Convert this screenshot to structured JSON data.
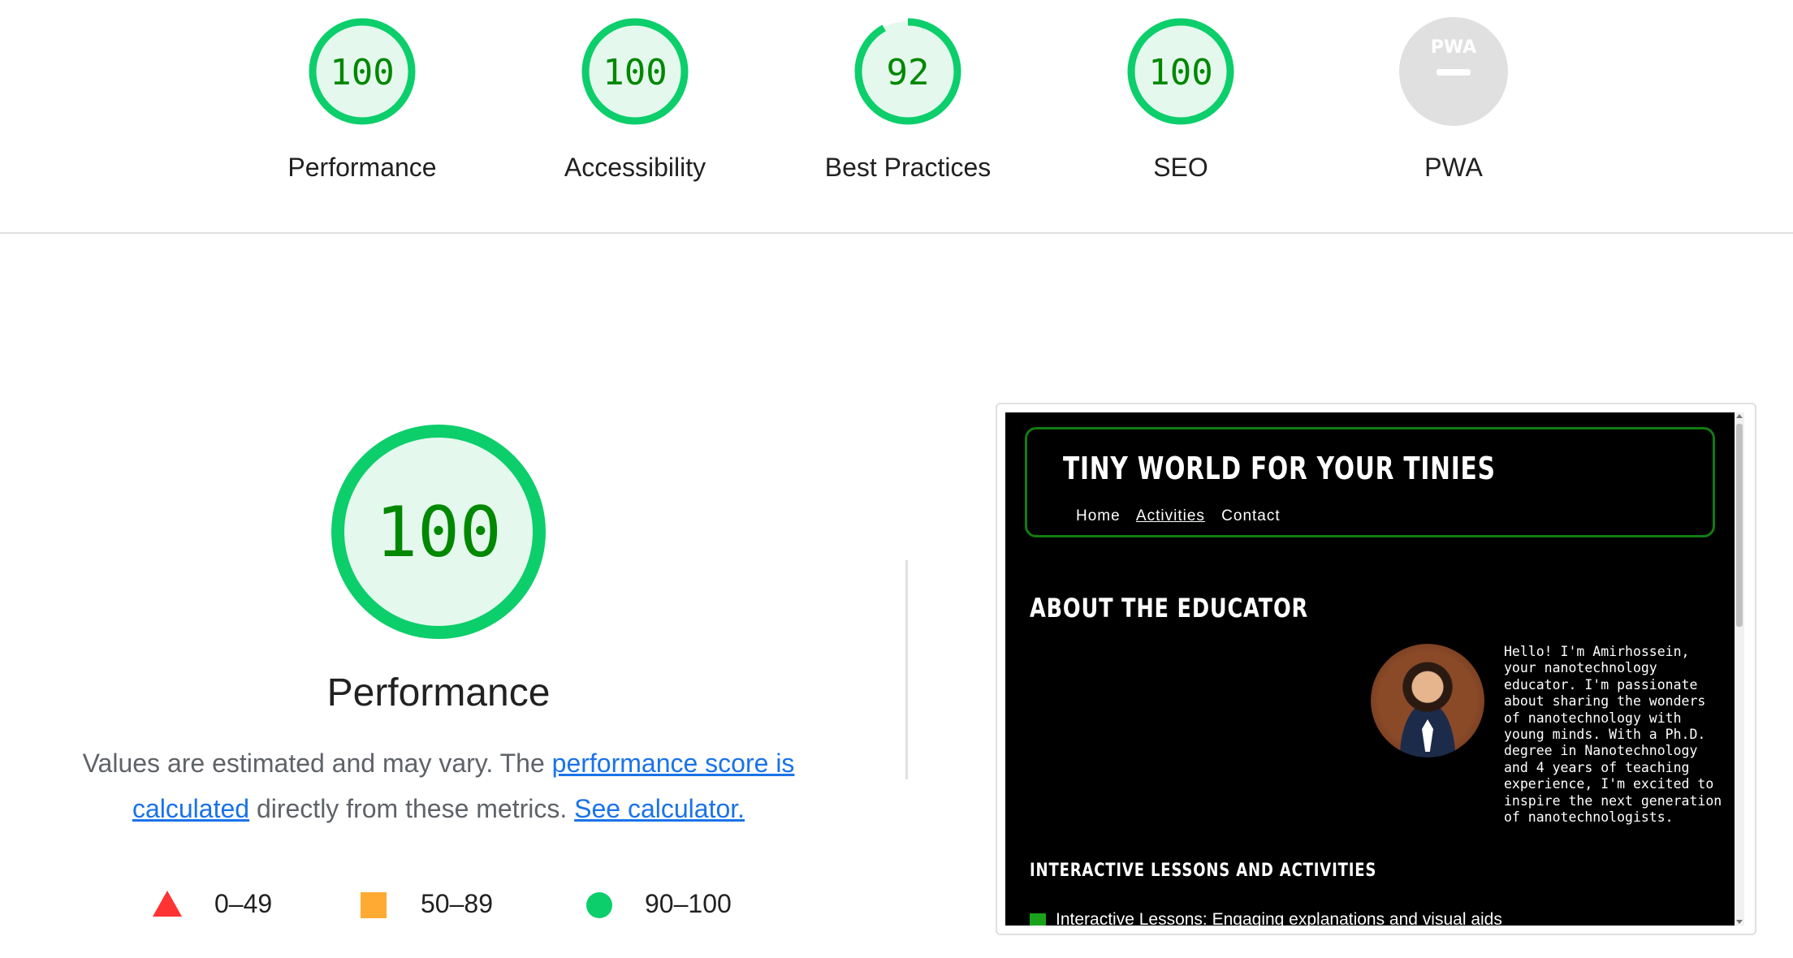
{
  "categories": [
    {
      "label": "Performance",
      "score": "100",
      "value": 100,
      "color": "#0cce6b"
    },
    {
      "label": "Accessibility",
      "score": "100",
      "value": 100,
      "color": "#0cce6b"
    },
    {
      "label": "Best Practices",
      "score": "92",
      "value": 92,
      "color": "#0cce6b"
    },
    {
      "label": "SEO",
      "score": "100",
      "value": 100,
      "color": "#0cce6b"
    },
    {
      "label": "PWA",
      "badge": "PWA",
      "value": null,
      "color": "#e0e0e0"
    }
  ],
  "summary": {
    "score": "100",
    "title": "Performance",
    "desc_pre": "Values are estimated and may vary. The ",
    "link_score": "performance score is calculated",
    "desc_mid": " directly from these metrics. ",
    "link_calc": "See calculator."
  },
  "legend": [
    {
      "range": "0–49",
      "shape": "triangle",
      "color": "#ff3333"
    },
    {
      "range": "50–89",
      "shape": "square",
      "color": "#ffaa33"
    },
    {
      "range": "90–100",
      "shape": "circle",
      "color": "#0cce6b"
    }
  ],
  "preview": {
    "site_title": "TINY WORLD FOR YOUR TINIES",
    "nav": [
      "Home",
      "Activities",
      "Contact"
    ],
    "about_heading": "ABOUT THE EDUCATOR",
    "bio": "Hello! I'm Amirhossein, your nanotechnology educator. I'm passionate about sharing the wonders of nanotechnology with young minds. With a Ph.D. degree in Nanotechnology and 4 years of teaching experience, I'm excited to inspire the next generation of nanotechnologists.",
    "lessons_heading": "INTERACTIVE LESSONS AND ACTIVITIES",
    "lesson_item": "Interactive Lessons: Engaging explanations and visual aids"
  }
}
